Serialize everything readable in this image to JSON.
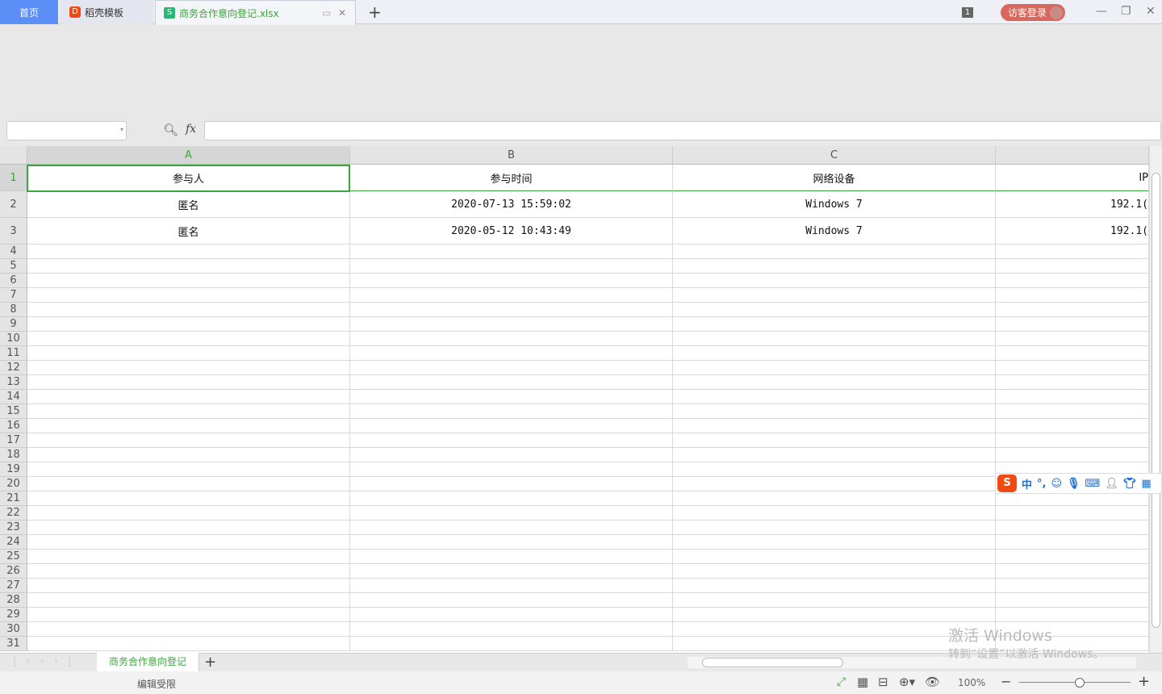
{
  "tabs": {
    "home": "首页",
    "template": "稻壳模板",
    "file": "商务合作意向登记.xlsx",
    "new": "+"
  },
  "titlebar": {
    "badge": "1",
    "login": "访客登录",
    "minimize": "—",
    "restore": "❐",
    "close": "✕"
  },
  "formula": {
    "fx": "fx",
    "value": ""
  },
  "columns": [
    "A",
    "B",
    "C",
    ""
  ],
  "header_row": [
    "参与人",
    "参与时间",
    "网络设备",
    "IP"
  ],
  "rows": [
    [
      "匿名",
      "2020-07-13 15:59:02",
      "Windows 7",
      "192.1("
    ],
    [
      "匿名",
      "2020-05-12 10:43:49",
      "Windows 7",
      "192.1("
    ]
  ],
  "row_numbers": [
    "1",
    "2",
    "3",
    "4",
    "5",
    "6",
    "7",
    "8",
    "9",
    "10",
    "11",
    "12",
    "13",
    "14",
    "15",
    "16",
    "17",
    "18",
    "19",
    "20",
    "21",
    "22",
    "23",
    "24",
    "25",
    "26",
    "27",
    "28",
    "29",
    "30",
    "31"
  ],
  "sheet": {
    "name": "商务合作意向登记",
    "add": "+"
  },
  "status": {
    "text": "编辑受限",
    "zoom": "100%",
    "zoom_fraction": 0.5
  },
  "ime": {
    "lang": "中",
    "punct": "°,"
  },
  "watermark": {
    "line1": "激活 Windows",
    "line2": "转到“设置”以激活 Windows。"
  },
  "colors": {
    "accent": "#3aa63a",
    "home_tab": "#5b8ef7",
    "login": "#d9675b"
  }
}
